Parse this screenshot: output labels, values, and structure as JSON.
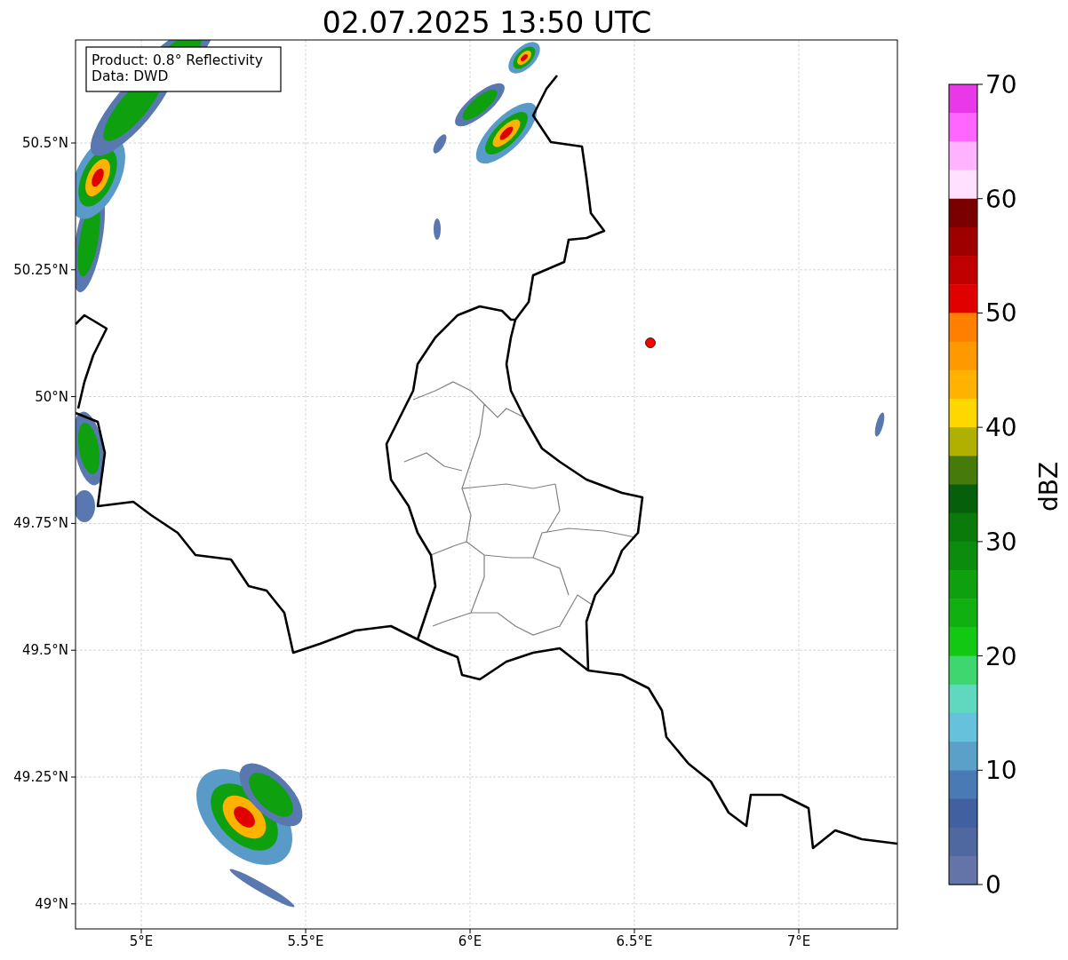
{
  "title": "02.07.2025 13:50 UTC",
  "info_box": [
    "Product: 0.8° Reflectivity",
    "Data: DWD"
  ],
  "map": {
    "x_ticks": [
      "5°E",
      "5.5°E",
      "6°E",
      "6.5°E",
      "7°E"
    ],
    "y_ticks": [
      "50.5°N",
      "50.25°N",
      "50°N",
      "49.75°N",
      "49.5°N",
      "49.25°N",
      "49°N"
    ],
    "marker": {
      "color": "#ff0000"
    }
  },
  "colorbar": {
    "label": "dBZ",
    "ticks": [
      "70",
      "60",
      "50",
      "40",
      "30",
      "20",
      "10",
      "0"
    ],
    "segments": [
      {
        "color": "#e838e8"
      },
      {
        "color": "#ff66ff"
      },
      {
        "color": "#ffb3ff"
      },
      {
        "color": "#ffe0ff"
      },
      {
        "color": "#7a0000"
      },
      {
        "color": "#9e0000"
      },
      {
        "color": "#c00000"
      },
      {
        "color": "#e00000"
      },
      {
        "color": "#ff7f00"
      },
      {
        "color": "#ff9900"
      },
      {
        "color": "#ffb300"
      },
      {
        "color": "#ffd700"
      },
      {
        "color": "#b0b000"
      },
      {
        "color": "#467a0a"
      },
      {
        "color": "#065f0a"
      },
      {
        "color": "#0a7a0a"
      },
      {
        "color": "#0c8c0c"
      },
      {
        "color": "#0ea00e"
      },
      {
        "color": "#10b010"
      },
      {
        "color": "#12c812"
      },
      {
        "color": "#3ed66e"
      },
      {
        "color": "#60d8c0"
      },
      {
        "color": "#66c2dc"
      },
      {
        "color": "#5aa0c8"
      },
      {
        "color": "#4a7ab4"
      },
      {
        "color": "#4060a0"
      },
      {
        "color": "#5068a0"
      },
      {
        "color": "#6474a8"
      }
    ]
  }
}
